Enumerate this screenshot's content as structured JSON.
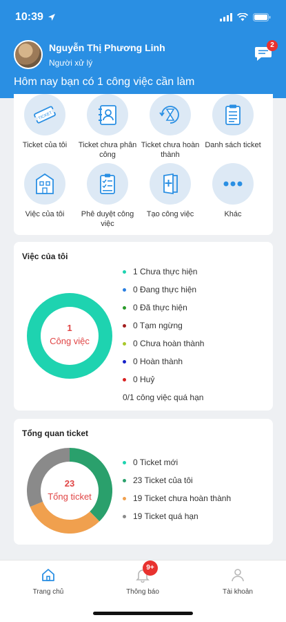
{
  "status_bar": {
    "time": "10:39"
  },
  "profile": {
    "name": "Nguyễn Thị Phương Linh",
    "role": "Người xử lý"
  },
  "messages": {
    "badge": "2",
    "icon": "chat-icon"
  },
  "greeting": "Hôm nay bạn có 1 công việc cần làm",
  "grid": [
    {
      "label": "Ticket của tôi",
      "icon": "ticket-icon"
    },
    {
      "label": "Ticket chưa phân công",
      "icon": "contact-book-icon"
    },
    {
      "label": "Ticket chưa hoàn thành",
      "icon": "hourglass-icon"
    },
    {
      "label": "Danh sách ticket",
      "icon": "clipboard-list-icon"
    },
    {
      "label": "Việc của tôi",
      "icon": "building-icon"
    },
    {
      "label": "Phê duyệt công việc",
      "icon": "checklist-icon"
    },
    {
      "label": "Tạo công việc",
      "icon": "new-document-icon"
    },
    {
      "label": "Khác",
      "icon": "more-icon"
    }
  ],
  "tasks_card": {
    "title": "Việc của tôi",
    "center_value": "1",
    "center_label": "Công việc",
    "legend": [
      {
        "text": "1 Chưa thực hiện",
        "color": "#1ed3b0"
      },
      {
        "text": "0 Đang thực hiện",
        "color": "#2a7fe0"
      },
      {
        "text": "0 Đã thực hiện",
        "color": "#2a9a2a"
      },
      {
        "text": "0 Tạm ngừng",
        "color": "#a31e1e"
      },
      {
        "text": "0 Chưa hoàn thành",
        "color": "#a8c82a"
      },
      {
        "text": "0 Hoàn thành",
        "color": "#1520c8"
      },
      {
        "text": "0 Huỷ",
        "color": "#d82020"
      }
    ],
    "overdue": "0/1 công việc quá hạn"
  },
  "tickets_card": {
    "title": "Tổng quan ticket",
    "center_value": "23",
    "center_label": "Tổng ticket",
    "legend": [
      {
        "text": "0 Ticket mới",
        "color": "#1ed3b0"
      },
      {
        "text": "23 Ticket của tôi",
        "color": "#2aa06c"
      },
      {
        "text": "19 Ticket chưa hoàn thành",
        "color": "#f0a04e"
      },
      {
        "text": "19 Ticket quá hạn",
        "color": "#8a8a8a"
      }
    ]
  },
  "chart_data": [
    {
      "type": "pie",
      "categories": [
        "Chưa thực hiện",
        "Đang thực hiện",
        "Đã thực hiện",
        "Tạm ngừng",
        "Chưa hoàn thành",
        "Hoàn thành",
        "Huỷ"
      ],
      "values": [
        1,
        0,
        0,
        0,
        0,
        0,
        0
      ],
      "colors": [
        "#1ed3b0",
        "#2a7fe0",
        "#2a9a2a",
        "#a31e1e",
        "#a8c82a",
        "#1520c8",
        "#d82020"
      ]
    },
    {
      "type": "pie",
      "categories": [
        "Ticket mới",
        "Ticket của tôi",
        "Ticket chưa hoàn thành",
        "Ticket quá hạn"
      ],
      "values": [
        0,
        23,
        19,
        19
      ],
      "colors": [
        "#1ed3b0",
        "#2aa06c",
        "#f0a04e",
        "#8a8a8a"
      ]
    }
  ],
  "bottom_nav": [
    {
      "label": "Trang chủ",
      "icon": "home-icon",
      "active": true
    },
    {
      "label": "Thông báo",
      "icon": "bell-icon",
      "badge": "9+"
    },
    {
      "label": "Tài khoản",
      "icon": "user-icon"
    }
  ]
}
